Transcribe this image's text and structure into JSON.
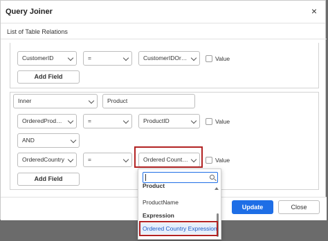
{
  "dialog": {
    "title": "Query Joiner",
    "close_glyph": "×",
    "section_title": "List of Table Relations"
  },
  "relation1": {
    "left_field": "CustomerID",
    "operator": "=",
    "right_field": "CustomerIDOrde...",
    "value_label": "Value",
    "add_field_label": "Add Field"
  },
  "relation2": {
    "join_type": "Inner",
    "table": "Product",
    "row1": {
      "left_field": "OrderedProduct...",
      "operator": "=",
      "right_field": "ProductID",
      "value_label": "Value"
    },
    "logic": "AND",
    "row2": {
      "left_field": "OrderedCountry",
      "operator": "=",
      "right_field": "Ordered Country ...",
      "value_label": "Value"
    },
    "add_field_label": "Add Field"
  },
  "popup": {
    "search_value": "",
    "items": [
      {
        "label": "Product",
        "type": "header"
      },
      {
        "label": "ProductName",
        "type": "item"
      },
      {
        "label": "Expression",
        "type": "header"
      },
      {
        "label": "Ordered Country Expression",
        "type": "selected"
      }
    ]
  },
  "footer": {
    "update_label": "Update",
    "close_label": "Close"
  },
  "colors": {
    "accent": "#1e6ee6",
    "highlight": "#b22222",
    "selected_bg": "#e6effc"
  },
  "icons": {
    "close": "close-icon",
    "search": "search-icon",
    "dropdown": "chevron-down-icon"
  }
}
